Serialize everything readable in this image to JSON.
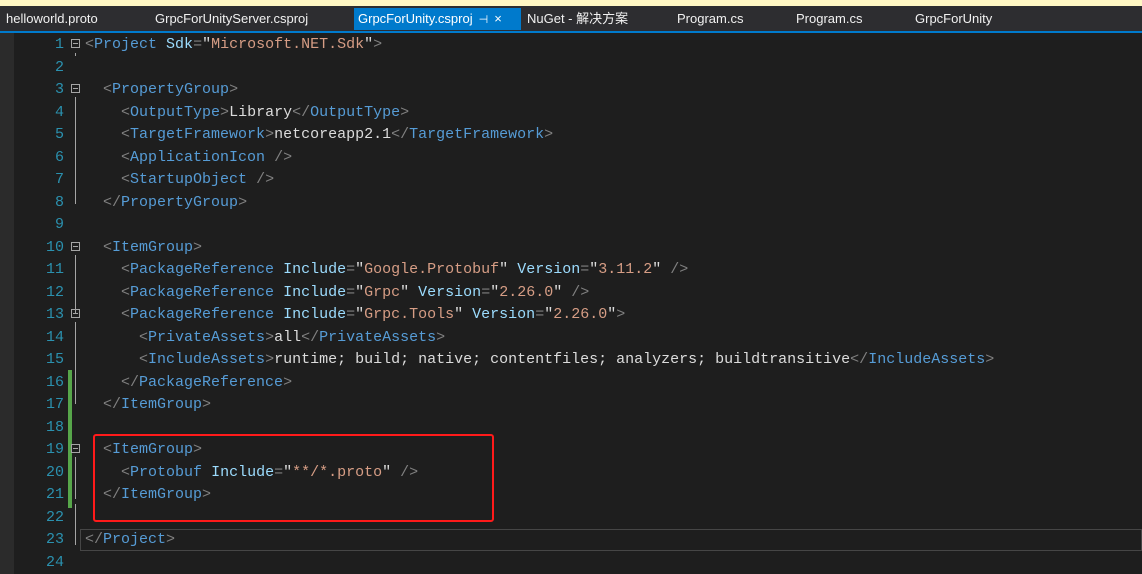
{
  "tabs": [
    {
      "label": "helloworld.proto"
    },
    {
      "label": "GrpcForUnityServer.csproj"
    },
    {
      "label": "GrpcForUnity.csproj",
      "active": true,
      "pin": "⊣",
      "close": "×"
    },
    {
      "label": "NuGet - 解决方案"
    },
    {
      "label": "Program.cs"
    },
    {
      "label": "Program.cs"
    },
    {
      "label": "GrpcForUnity"
    }
  ],
  "lines": [
    {
      "n": "1"
    },
    {
      "n": "2"
    },
    {
      "n": "3"
    },
    {
      "n": "4"
    },
    {
      "n": "5"
    },
    {
      "n": "6"
    },
    {
      "n": "7"
    },
    {
      "n": "8"
    },
    {
      "n": "9"
    },
    {
      "n": "10"
    },
    {
      "n": "11"
    },
    {
      "n": "12"
    },
    {
      "n": "13"
    },
    {
      "n": "14"
    },
    {
      "n": "15"
    },
    {
      "n": "16"
    },
    {
      "n": "17"
    },
    {
      "n": "18"
    },
    {
      "n": "19"
    },
    {
      "n": "20"
    },
    {
      "n": "21"
    },
    {
      "n": "22"
    },
    {
      "n": "23"
    },
    {
      "n": "24"
    }
  ],
  "code": {
    "project_tag": "Project",
    "sdk_attr": "Sdk",
    "sdk_value": "Microsoft.NET.Sdk",
    "property_group": "PropertyGroup",
    "output_type": "OutputType",
    "output_type_value": "Library",
    "target_framework": "TargetFramework",
    "target_framework_value": "netcoreapp2.1",
    "application_icon": "ApplicationIcon",
    "startup_object": "StartupObject",
    "item_group": "ItemGroup",
    "package_reference": "PackageReference",
    "include_attr": "Include",
    "version_attr": "Version",
    "pkg1_name": "Google.Protobuf",
    "pkg1_version": "3.11.2",
    "pkg2_name": "Grpc",
    "pkg2_version": "2.26.0",
    "pkg3_name": "Grpc.Tools",
    "pkg3_version": "2.26.0",
    "private_assets": "PrivateAssets",
    "private_assets_value": "all",
    "include_assets": "IncludeAssets",
    "include_assets_value": "runtime; build; native; contentfiles; analyzers; buildtransitive",
    "protobuf_tag": "Protobuf",
    "protobuf_include": "**/*.proto"
  },
  "colors": {
    "tab_active": "#007acc",
    "line_number": "#2b91af",
    "xml_tag": "#569cd6",
    "xml_attr": "#9cdcfe",
    "attr_value": "#d69d85",
    "highlight_box": "#ff1a1a",
    "change_marker": "#57a64a"
  }
}
